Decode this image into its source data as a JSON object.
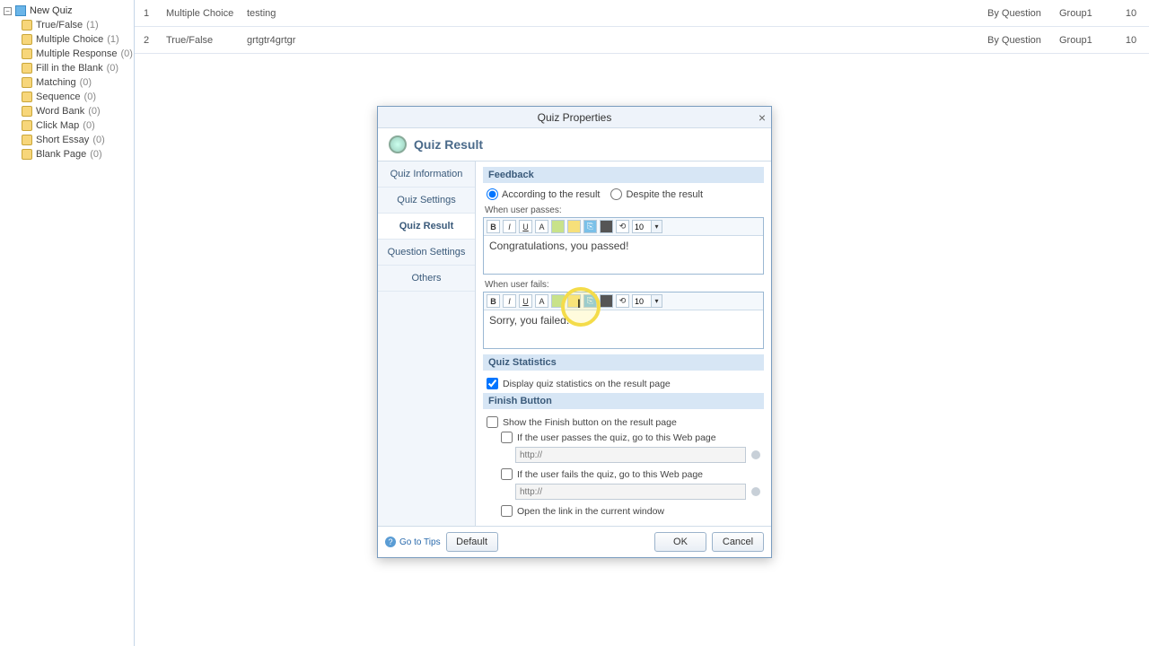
{
  "tree": {
    "root": "New Quiz",
    "items": [
      {
        "label": "True/False",
        "count": "(1)"
      },
      {
        "label": "Multiple Choice",
        "count": "(1)"
      },
      {
        "label": "Multiple Response",
        "count": "(0)"
      },
      {
        "label": "Fill in the Blank",
        "count": "(0)"
      },
      {
        "label": "Matching",
        "count": "(0)"
      },
      {
        "label": "Sequence",
        "count": "(0)"
      },
      {
        "label": "Word Bank",
        "count": "(0)"
      },
      {
        "label": "Click Map",
        "count": "(0)"
      },
      {
        "label": "Short Essay",
        "count": "(0)"
      },
      {
        "label": "Blank Page",
        "count": "(0)"
      }
    ]
  },
  "rows": [
    {
      "n": "1",
      "type": "Multiple Choice",
      "title": "testing",
      "by": "By Question",
      "group": "Group1",
      "pts": "10"
    },
    {
      "n": "2",
      "type": "True/False",
      "title": "grtgtr4grtgr",
      "by": "By Question",
      "group": "Group1",
      "pts": "10"
    }
  ],
  "dialog": {
    "title": "Quiz Properties",
    "header": "Quiz Result",
    "nav": [
      "Quiz Information",
      "Quiz Settings",
      "Quiz Result",
      "Question Settings",
      "Others"
    ],
    "feedback": {
      "heading": "Feedback",
      "radio1": "According to the result",
      "radio2": "Despite the result",
      "passLabel": "When user passes:",
      "passText": "Congratulations, you passed!",
      "failLabel": "When user fails:",
      "failText": "Sorry, you failed.",
      "fontsize": "10"
    },
    "stats": {
      "heading": "Quiz Statistics",
      "check": "Display quiz statistics on the result page"
    },
    "finish": {
      "heading": "Finish Button",
      "show": "Show the Finish button on the result page",
      "passUrl": "If the user passes the quiz, go to this Web page",
      "failUrl": "If the user fails the quiz, go to this Web page",
      "openCurrent": "Open the link in the current window",
      "placeholder": "http://"
    },
    "footer": {
      "tips": "Go to Tips",
      "default": "Default",
      "ok": "OK",
      "cancel": "Cancel"
    }
  }
}
